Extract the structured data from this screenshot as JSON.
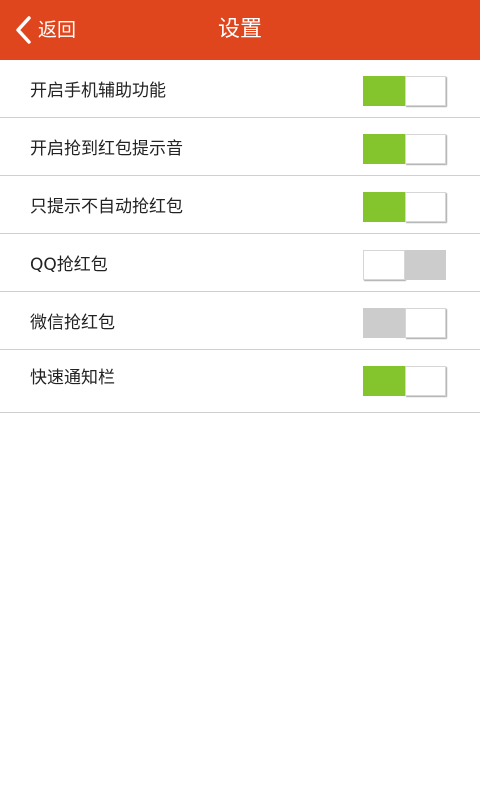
{
  "header": {
    "back_label": "返回",
    "title": "设置",
    "background": "#e0461d"
  },
  "settings": [
    {
      "label": "开启手机辅助功能",
      "enabled": true
    },
    {
      "label": "开启抢到红包提示音",
      "enabled": true
    },
    {
      "label": "只提示不自动抢红包",
      "enabled": true
    },
    {
      "label": "QQ抢红包",
      "enabled": false
    },
    {
      "label": "微信抢红包",
      "enabled": false
    },
    {
      "label": "快速通知栏",
      "enabled": true
    }
  ],
  "colors": {
    "toggle_on": "#84c52e",
    "toggle_off": "#cccccc"
  },
  "icons": {
    "back": "chevron-left-icon"
  }
}
